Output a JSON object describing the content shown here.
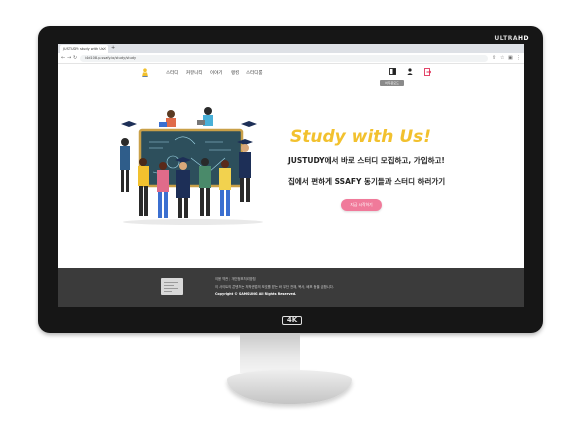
{
  "monitor": {
    "brand": "ULTRA",
    "brand_suffix": "HD",
    "logo": "4K"
  },
  "browser": {
    "tab_title": "JUSTUDY: study with Us",
    "tab_close": "×",
    "new_tab": "+",
    "url": "i4d108.p.ssafy.io/study/study",
    "icons": [
      "back-arrow-icon",
      "forward-arrow-icon",
      "reload-icon",
      "share-icon",
      "star-icon",
      "extension-icon",
      "menu-icon"
    ]
  },
  "site": {
    "menu": [
      "스터디",
      "커뮤니티",
      "이야기",
      "랭킹",
      "스터디룸"
    ],
    "tooltip": "어두운모드",
    "hero": {
      "title": "Study with Us!",
      "line1": "JUSTUDY에서 바로 스터디 모집하고, 가입하고!",
      "line2": "집에서 편하게 SSAFY 동기들과 스터디 하러가기",
      "cta": "지금 시작하기"
    },
    "footer": {
      "link1": "이용 약관",
      "separator": "|",
      "link2": "개인정보처리방침",
      "desc": "이 사이트의 콘텐츠는 저작권법의 보호를 받는 바 무단 전재, 복사, 배포 등을 금합니다.",
      "copyright": "Copyright © SAMSUNG All Rights Reserved."
    }
  },
  "colors": {
    "accent_yellow": "#f2c12e",
    "cta_pink": "#f07a9a",
    "footer_bg": "#3b3b3b",
    "logout_red": "#e0335a"
  }
}
